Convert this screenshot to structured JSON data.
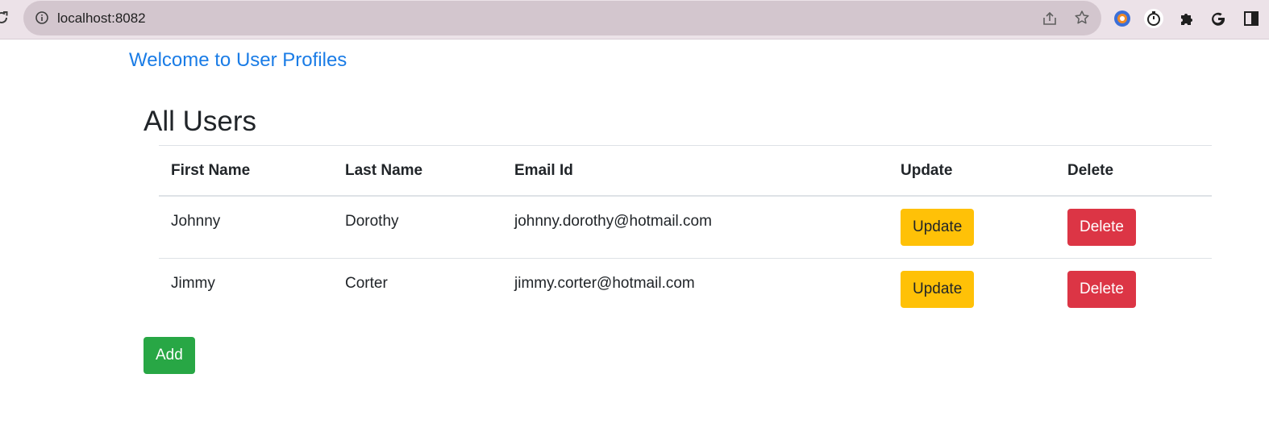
{
  "browser": {
    "url": "localhost:8082"
  },
  "page": {
    "welcome_link": "Welcome to User Profiles",
    "title": "All Users",
    "add_button": "Add"
  },
  "table": {
    "headers": {
      "first_name": "First Name",
      "last_name": "Last Name",
      "email": "Email Id",
      "update": "Update",
      "delete": "Delete"
    },
    "rows": [
      {
        "first_name": "Johnny",
        "last_name": "Dorothy",
        "email": "johnny.dorothy@hotmail.com",
        "update_label": "Update",
        "delete_label": "Delete"
      },
      {
        "first_name": "Jimmy",
        "last_name": "Corter",
        "email": "jimmy.corter@hotmail.com",
        "update_label": "Update",
        "delete_label": "Delete"
      }
    ]
  },
  "colors": {
    "link": "#1a7ce6",
    "update_button": "#ffc107",
    "delete_button": "#dc3545",
    "add_button": "#28a745"
  },
  "icons": {
    "reload": "reload-icon",
    "site_info": "info-icon",
    "share": "share-icon",
    "bookmark": "star-icon",
    "extensions": [
      "extension-color-icon",
      "timer-icon",
      "puzzle-icon",
      "google-icon",
      "sidebar-icon"
    ]
  }
}
